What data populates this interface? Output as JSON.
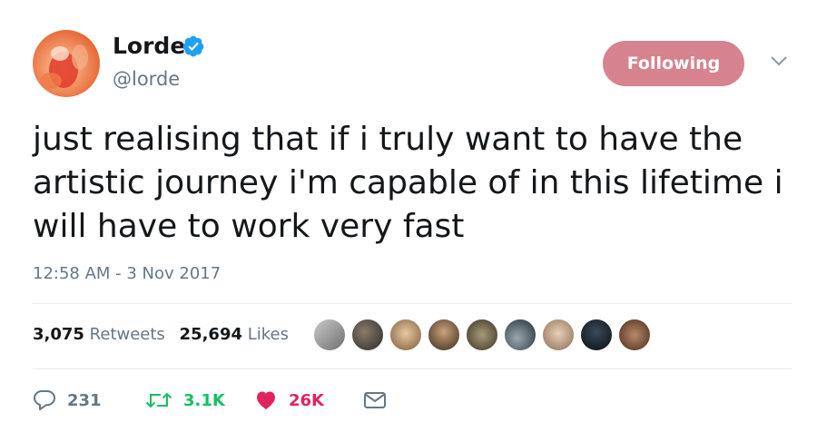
{
  "user": {
    "name": "Lorde",
    "handle": "@lorde"
  },
  "follow_button": {
    "label": "Following"
  },
  "tweet": {
    "text": "just realising that if i truly want to have the\nartistic journey i'm capable of in this lifetime i\nwill have to work very fast",
    "timestamp": "12:58 AM - 3 Nov 2017"
  },
  "stats": {
    "retweets_count": "3,075",
    "retweets_label": "Retweets",
    "likes_count": "25,694",
    "likes_label": "Likes"
  },
  "actions": {
    "reply_count": "231",
    "retweet_count": "3.1K",
    "like_count": "26K"
  },
  "colors": {
    "following_button": "#d6838f",
    "verified": "#1da1f2",
    "retweet_green": "#17bf63",
    "like_red": "#e0245e",
    "secondary_text": "#657786"
  },
  "icons": [
    "verified-badge-icon",
    "chevron-down-icon",
    "reply-icon",
    "retweet-icon",
    "heart-icon",
    "direct-message-icon"
  ]
}
